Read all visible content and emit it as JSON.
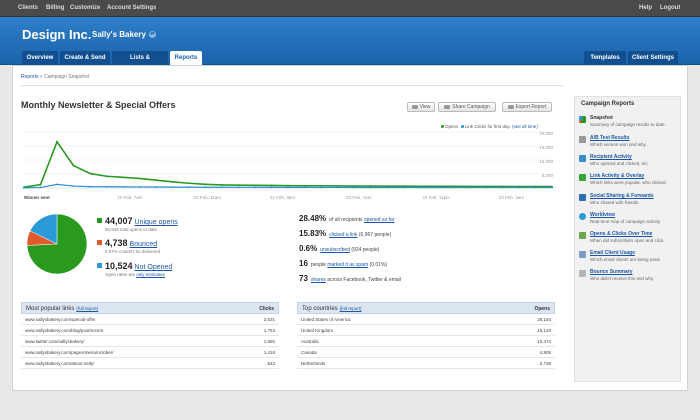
{
  "topnav": {
    "links": [
      "Clients",
      "Billing",
      "Customize",
      "Account Settings"
    ],
    "right": [
      "Help",
      "Logout"
    ]
  },
  "brand": {
    "name": "Design Inc.",
    "client": "Sally's Bakery"
  },
  "tabs": [
    "Overview",
    "Create & Send",
    "Lists & Subscribers",
    "Reports"
  ],
  "right_tabs": [
    "Templates",
    "Client Settings"
  ],
  "breadcrumb": {
    "root": "Reports",
    "sep": "»",
    "current": "Campaign Snapshot"
  },
  "campaign": {
    "title": "Monthly Newsletter & Special Offers",
    "buttons": {
      "view": "View",
      "share": "Share Campaign",
      "export": "Export Report"
    }
  },
  "legend": {
    "opens": "Opens",
    "clicks": "Link Clicks for first day.",
    "see_all": "(see all time)"
  },
  "colors": {
    "opens": "#2a9a1f",
    "clicks": "#2a8fd6",
    "bounced": "#e05a2a",
    "not_opened": "#2a9ad8",
    "brand_blue": "#1b63ab"
  },
  "chart_data": {
    "type": "line",
    "x": [
      "Winner sent",
      "",
      "",
      "",
      "",
      "",
      "",
      "",
      "",
      "",
      "",
      "",
      "",
      "",
      "",
      "",
      "",
      "",
      "",
      "",
      "",
      "",
      "",
      "",
      "",
      "",
      "",
      "",
      "",
      "",
      "",
      "",
      ""
    ],
    "x_tick_labels": [
      "Winner sent",
      "22 Feb, 7am",
      "22 Feb, 11am",
      "22 Feb, 3pm",
      "22 Feb, 7pm",
      "22 Feb, 11pm",
      "23 Feb, 3am"
    ],
    "y_tick_labels": [
      "20,000",
      "15,000",
      "10,000",
      "5,000"
    ],
    "ylim": [
      0,
      20000
    ],
    "series": [
      {
        "name": "Opens",
        "values": [
          300,
          1200,
          16500,
          8000,
          5200,
          4200,
          3800,
          3400,
          2800,
          2200,
          1700,
          1300,
          1100,
          1000,
          950,
          900,
          850,
          800,
          800,
          750,
          700,
          700,
          650,
          650,
          600,
          600,
          600,
          550,
          550,
          550,
          500,
          500,
          500
        ]
      },
      {
        "name": "Link Clicks for first day.",
        "values": [
          50,
          200,
          1300,
          700,
          500,
          450,
          400,
          380,
          350,
          320,
          300,
          280,
          260,
          250,
          240,
          230,
          220,
          210,
          200,
          200,
          190,
          190,
          180,
          180,
          170,
          170,
          160,
          160,
          160,
          150,
          150,
          150,
          150
        ]
      }
    ]
  },
  "metrics": [
    {
      "value": "44,007",
      "label": "Unique opens",
      "sub": "90,916 total opens to date"
    },
    {
      "value": "4,738",
      "label": "Bounced",
      "sub": "2.97% couldn't be delivered"
    },
    {
      "value": "10,524",
      "label": "Not Opened",
      "sub1": "Open rates are ",
      "sub2": "only estimates"
    }
  ],
  "pie": [
    {
      "name": "Opened",
      "value": 44007
    },
    {
      "name": "Bounced",
      "value": 4738
    },
    {
      "name": "Not Opened",
      "value": 10524
    }
  ],
  "stats": [
    {
      "val": "28.48%",
      "pre": "of all recipients ",
      "link": "opened so far",
      "post": ""
    },
    {
      "val": "15.83%",
      "pre": "",
      "link": "clicked a link",
      "post": " (6,967 people)"
    },
    {
      "val": "0.6%",
      "pre": "",
      "link": "unsubscribed",
      "post": " (924 people)"
    },
    {
      "val": "16",
      "pre": "people ",
      "link": "marked it as spam",
      "post": " (0.01%)"
    },
    {
      "val": "73",
      "pre": "",
      "link": "shares",
      "post": " across Facebook, Twitter & email"
    }
  ],
  "links_table": {
    "title": "Most popular links",
    "full": "(full report)",
    "col": "Clicks",
    "rows": [
      [
        "www.sallysbakery.com/special-offer",
        "3,531"
      ],
      [
        "www.sallysbakery.com/blog/post/recent",
        "1,763"
      ],
      [
        "www.twitter.com/sallysbakery/",
        "1,550"
      ],
      [
        "www.sallysbakery.com/pages/menu/october/",
        "1,418"
      ],
      [
        "www.sallysbakery.com/about-sally/",
        "643"
      ]
    ]
  },
  "countries_table": {
    "title": "Top countries",
    "full": "(full report)",
    "col": "Opens",
    "rows": [
      [
        "United States of America",
        "28,154"
      ],
      [
        "United Kingdom",
        "15,120"
      ],
      [
        "Australia",
        "10,474"
      ],
      [
        "Canada",
        "4,805"
      ],
      [
        "Netherlands",
        "2,738"
      ]
    ]
  },
  "sidebar": {
    "title": "Campaign Reports",
    "items": [
      {
        "label": "Snapshot",
        "desc": "Summary of campaign results to date.",
        "link": false,
        "icon": "pie-chart-icon"
      },
      {
        "label": "A/B Test Results",
        "desc": "Which version won and why.",
        "link": true,
        "icon": "ab-test-icon"
      },
      {
        "label": "Recipient Activity",
        "desc": "Who opened and clicked, etc.",
        "link": true,
        "icon": "people-icon"
      },
      {
        "label": "Link Activity & Overlay",
        "desc": "Which links were popular, who clicked.",
        "link": true,
        "icon": "link-icon"
      },
      {
        "label": "Social Sharing & Forwards",
        "desc": "Who shared with friends.",
        "link": true,
        "icon": "share-icon"
      },
      {
        "label": "Worldview",
        "desc": "Real-time map of campaign activity.",
        "link": true,
        "icon": "globe-icon"
      },
      {
        "label": "Opens & Clicks Over Time",
        "desc": "When did subscribers open and click.",
        "link": true,
        "icon": "clock-icon"
      },
      {
        "label": "Email Client Usage",
        "desc": "Which email clients are being used.",
        "link": true,
        "icon": "mail-icon"
      },
      {
        "label": "Bounce Summary",
        "desc": "Who didn't receive this and why.",
        "link": true,
        "icon": "bounce-icon"
      }
    ]
  }
}
